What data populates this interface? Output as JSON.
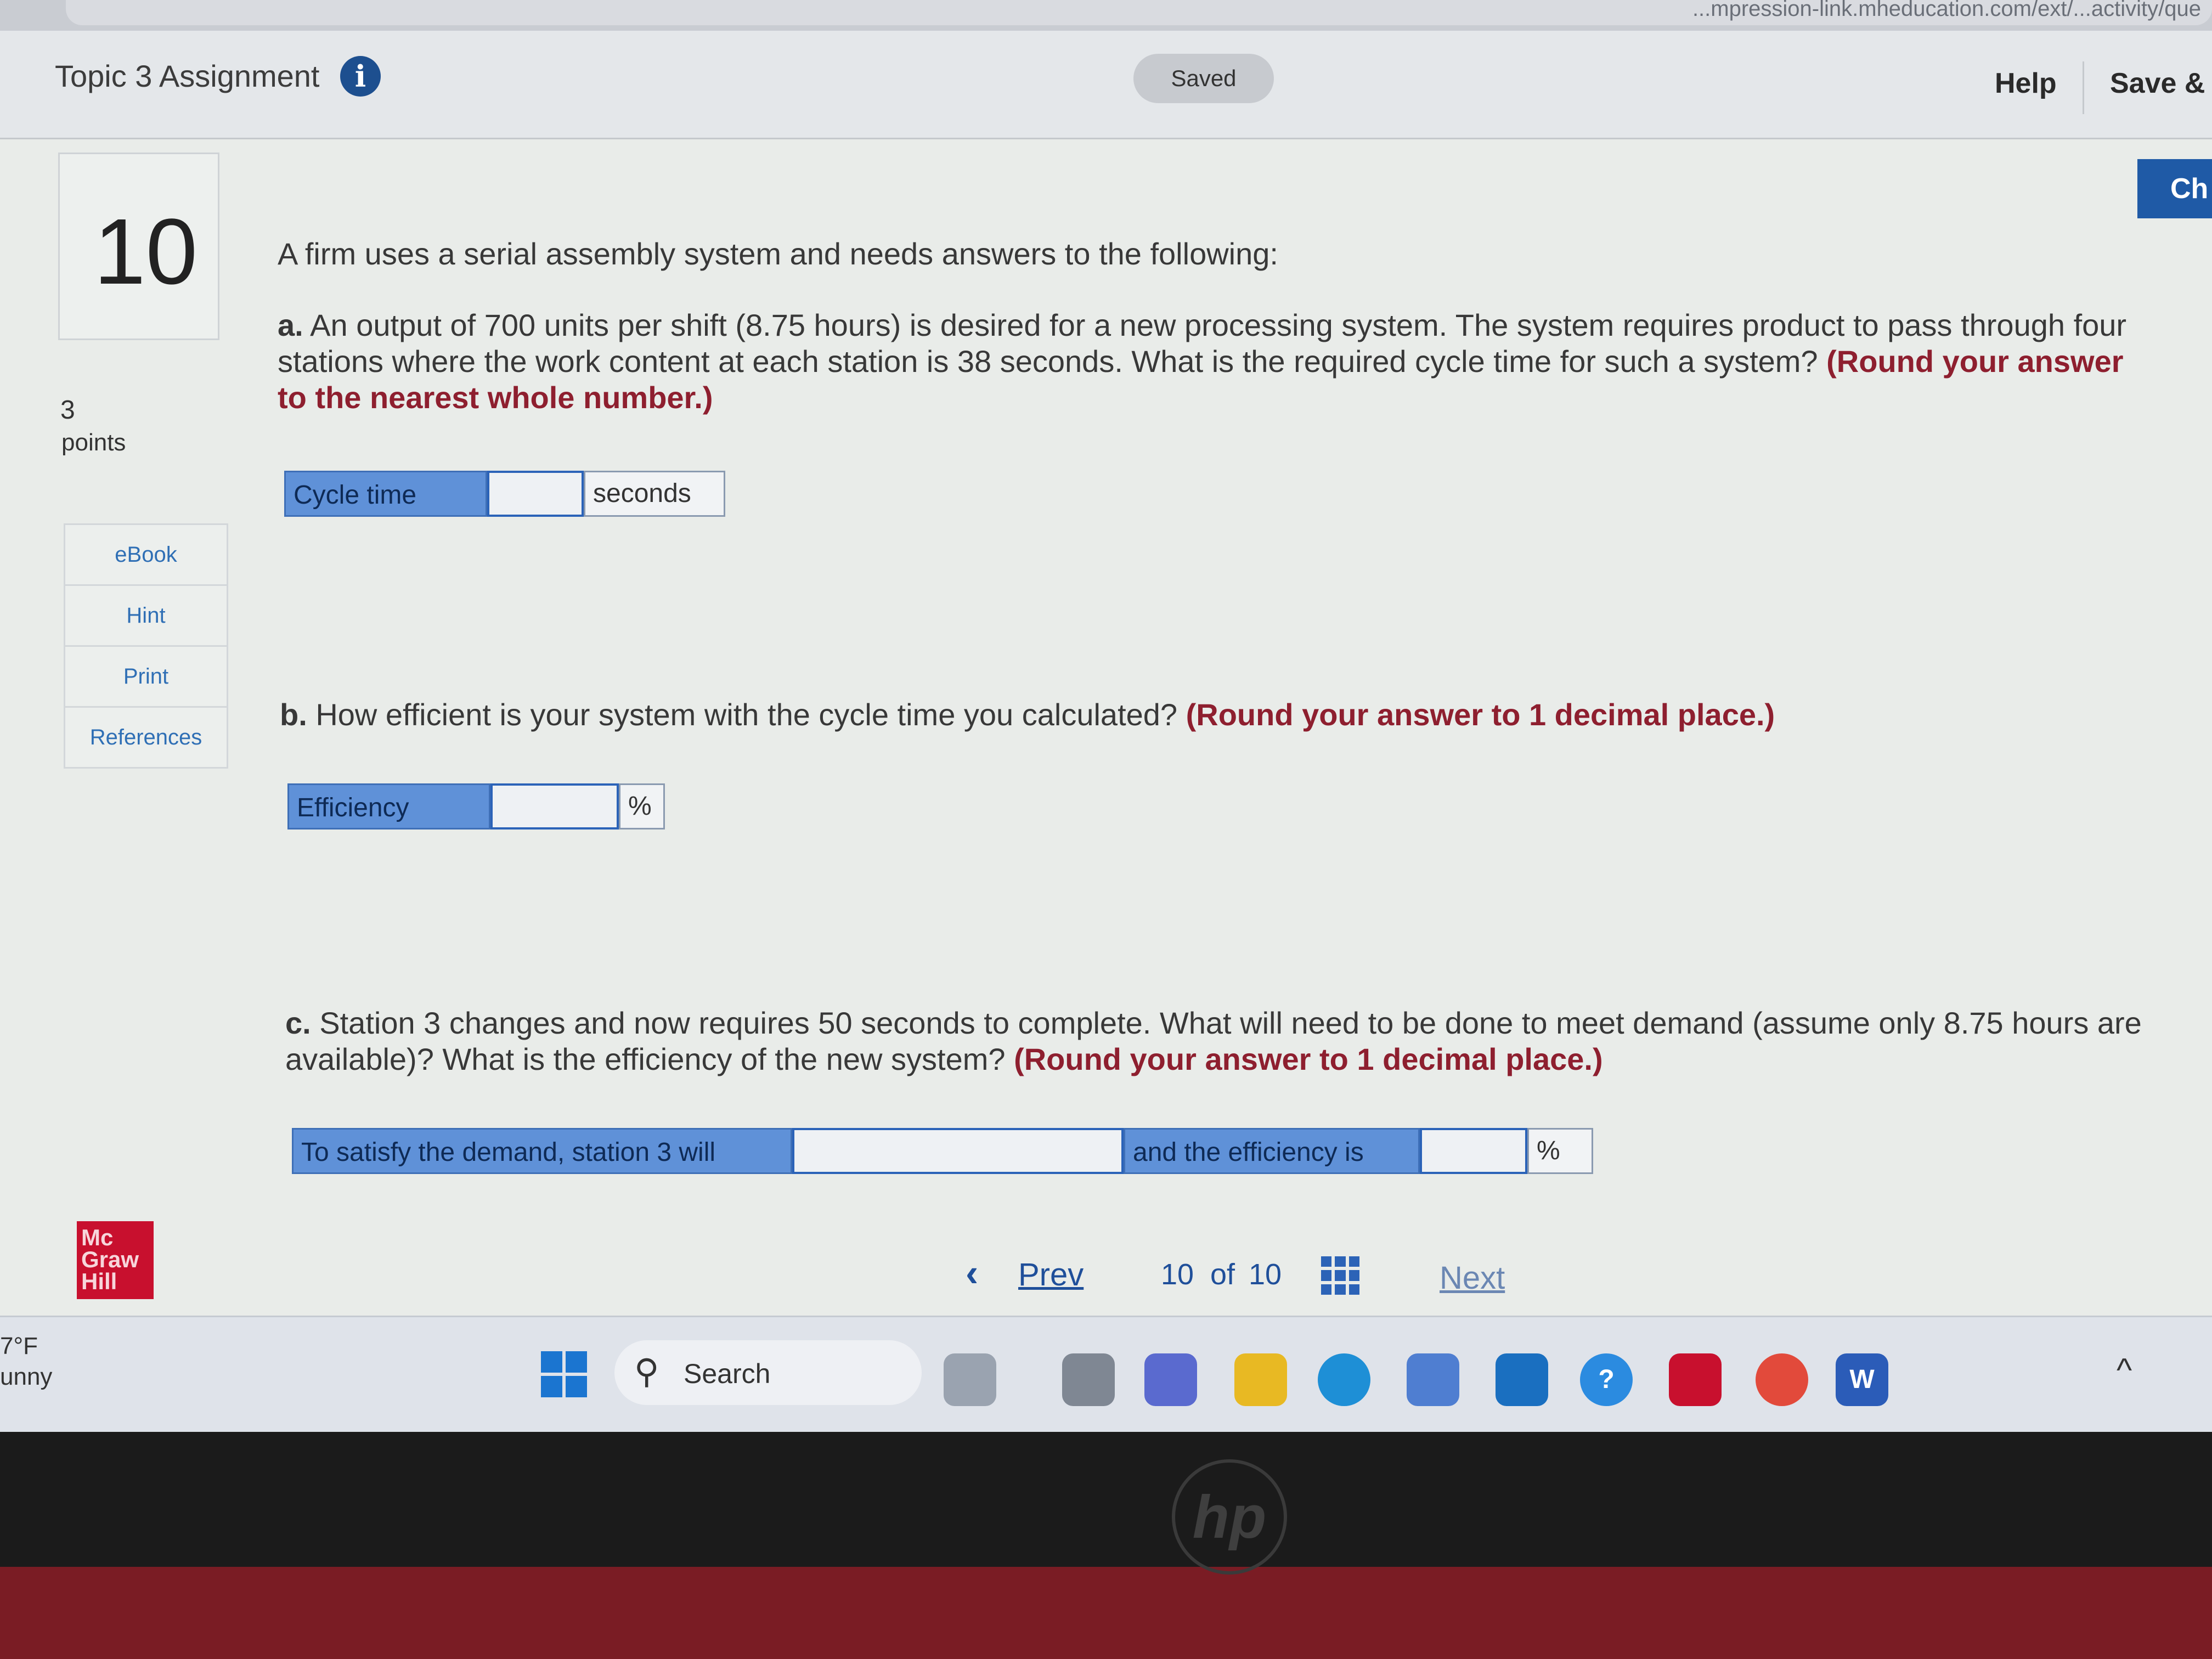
{
  "browser": {
    "url_fragment": "...mpression-link.mheducation.com/ext/...activity/que"
  },
  "header": {
    "title": "Topic 3 Assignment",
    "info_icon": "info-icon",
    "status_badge": "Saved",
    "help_label": "Help",
    "save_exit_label": "Save & E",
    "check_label": "Ch"
  },
  "question": {
    "number": "10",
    "points_value": "3",
    "points_label": "points",
    "intro": "A firm uses a serial assembly system and needs answers to the following:",
    "part_a": {
      "prefix": "a.",
      "text": "An output of 700 units per shift (8.75 hours) is desired for a new processing system. The system requires product to pass through four stations where the work content at each station is 38 seconds. What is the required cycle time for such a system?",
      "instruction": "(Round your answer to the nearest whole number.)",
      "field_label": "Cycle time",
      "field_value": "",
      "unit": "seconds"
    },
    "part_b": {
      "prefix": "b.",
      "text": "How efficient is your system with the cycle time you calculated?",
      "instruction": "(Round your answer to 1 decimal place.)",
      "field_label": "Efficiency",
      "field_value": "",
      "unit": "%"
    },
    "part_c": {
      "prefix": "c.",
      "text": "Station 3 changes and now requires 50 seconds to complete. What will need to be done to meet demand (assume only 8.75 hours are available)? What is the efficiency of the new system?",
      "instruction": "(Round your answer to 1 decimal place.)",
      "field1_label": "To satisfy the demand, station 3 will",
      "field1_value": "",
      "field2_label": "and the efficiency is",
      "field2_value": "",
      "unit": "%"
    }
  },
  "sidebar": {
    "items": [
      {
        "label": "eBook"
      },
      {
        "label": "Hint"
      },
      {
        "label": "Print"
      },
      {
        "label": "References"
      }
    ],
    "logo_text": "Mc Graw Hill"
  },
  "pager": {
    "prev_label": "Prev",
    "current": "10",
    "of_label": "of",
    "total": "10",
    "next_label": "Next"
  },
  "taskbar": {
    "weather_temp": "7°F",
    "weather_condition": "unny",
    "search_label": "Search",
    "apps": [
      "start-icon",
      "file-explorer-icon",
      "edge-icon",
      "store-icon",
      "myhp-icon",
      "help-icon",
      "mcafee-icon",
      "chrome-icon",
      "word-icon"
    ]
  },
  "device": {
    "brand": "hp"
  }
}
